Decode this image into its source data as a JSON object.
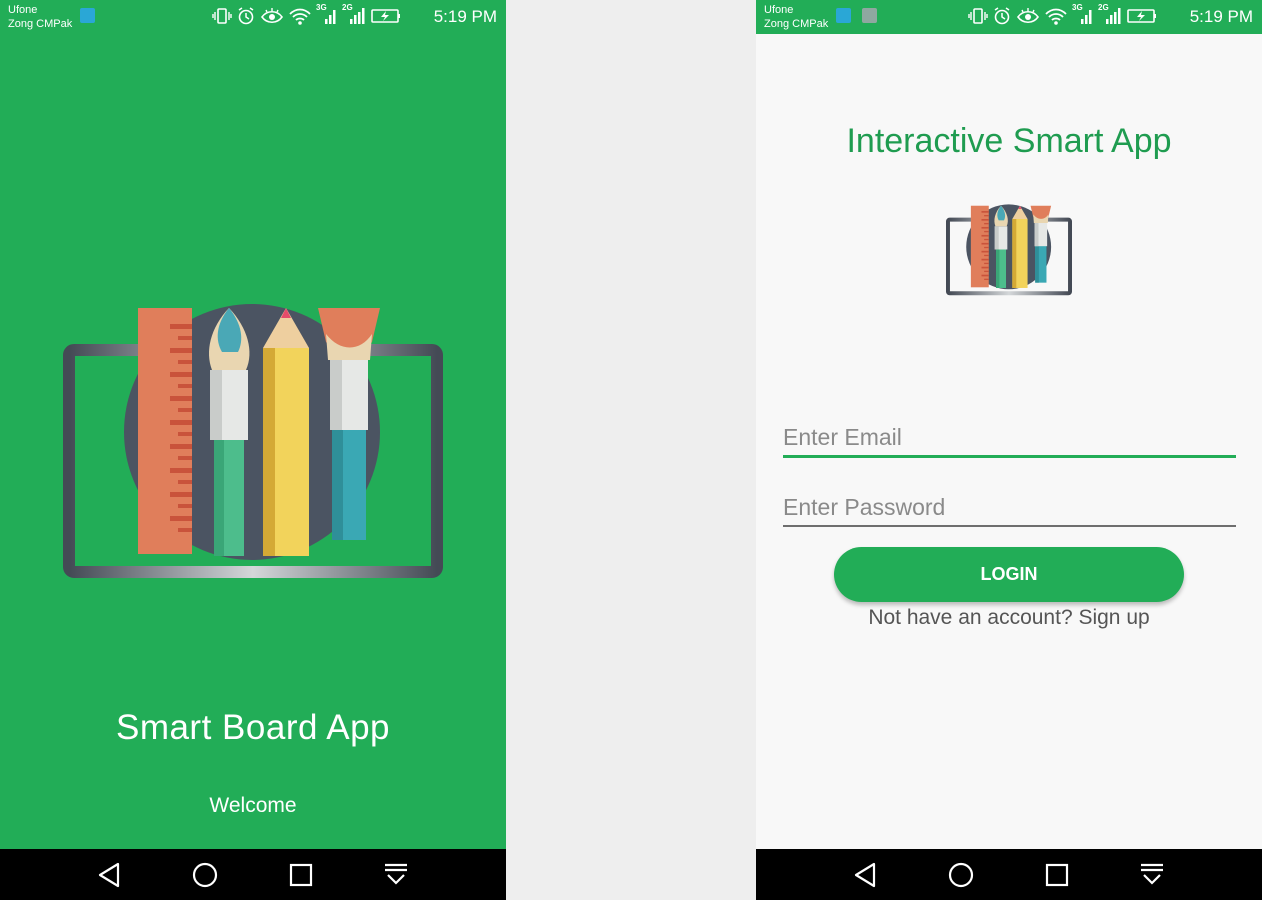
{
  "status_bar": {
    "carrier_primary": "Ufone",
    "carrier_secondary": "Zong CMPak",
    "net_label_1": "3G",
    "net_label_2": "2G",
    "time": "5:19 PM",
    "icons": [
      "vibrate-icon",
      "alarm-icon",
      "eye-comfort-icon",
      "wifi-icon",
      "signal-3g-icon",
      "signal-2g-icon",
      "battery-charging-icon"
    ]
  },
  "splash": {
    "title": "Smart Board App",
    "subtitle": "Welcome",
    "background": "#22ad57"
  },
  "login": {
    "title": "Interactive Smart App",
    "email_placeholder": "Enter Email",
    "password_placeholder": "Enter Password",
    "login_label": "LOGIN",
    "signup_text": "Not have an account? Sign up",
    "accent": "#22ad57"
  },
  "nav_bar": {
    "buttons": [
      "back-icon",
      "home-icon",
      "recents-icon",
      "notification-shade-icon"
    ]
  }
}
